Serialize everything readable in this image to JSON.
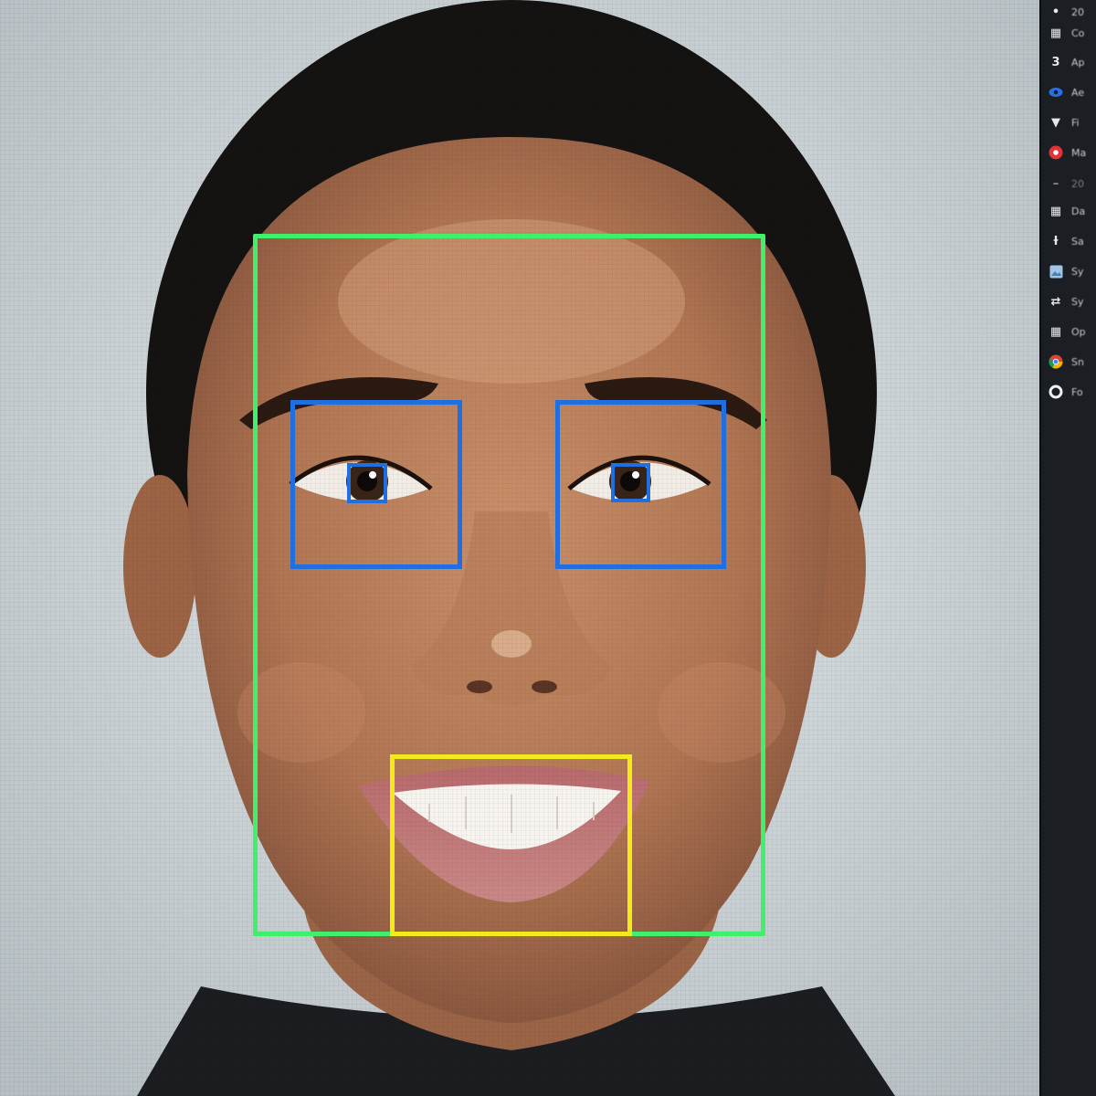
{
  "colors": {
    "face_box": "#3ef06a",
    "eye_box": "#1f6fe0",
    "mouth_box": "#f3ea1c",
    "panel_bg": "#1b1f23"
  },
  "detections": [
    {
      "label": "",
      "color": "#3ef06a"
    },
    {
      "label": "",
      "color": "#1f6fe0"
    },
    {
      "label": "",
      "color": "#1f6fe0"
    },
    {
      "label": "",
      "color": "#1f6fe0"
    },
    {
      "label": "",
      "color": "#1f6fe0"
    },
    {
      "label": "",
      "color": "#f3ea1c"
    }
  ],
  "side_panel": {
    "items": [
      {
        "icon": "dot-icon",
        "label": "20"
      },
      {
        "icon": "grid-icon",
        "label": "Co"
      },
      {
        "icon": "number-three-icon",
        "label": "Ap"
      },
      {
        "icon": "eye-icon",
        "label": "Ae"
      },
      {
        "icon": "filter-icon",
        "label": "Fi"
      },
      {
        "icon": "record-icon",
        "label": "Ma"
      },
      {
        "icon": "dash-icon",
        "label": "20"
      },
      {
        "icon": "grid-icon",
        "label": "Da"
      },
      {
        "icon": "pin-icon",
        "label": "Sa"
      },
      {
        "icon": "image-icon",
        "label": "Sy"
      },
      {
        "icon": "sync-icon",
        "label": "Sy"
      },
      {
        "icon": "grid-icon",
        "label": "Op"
      },
      {
        "icon": "chrome-icon",
        "label": "Sn"
      },
      {
        "icon": "ring-icon",
        "label": "Fo"
      }
    ]
  }
}
